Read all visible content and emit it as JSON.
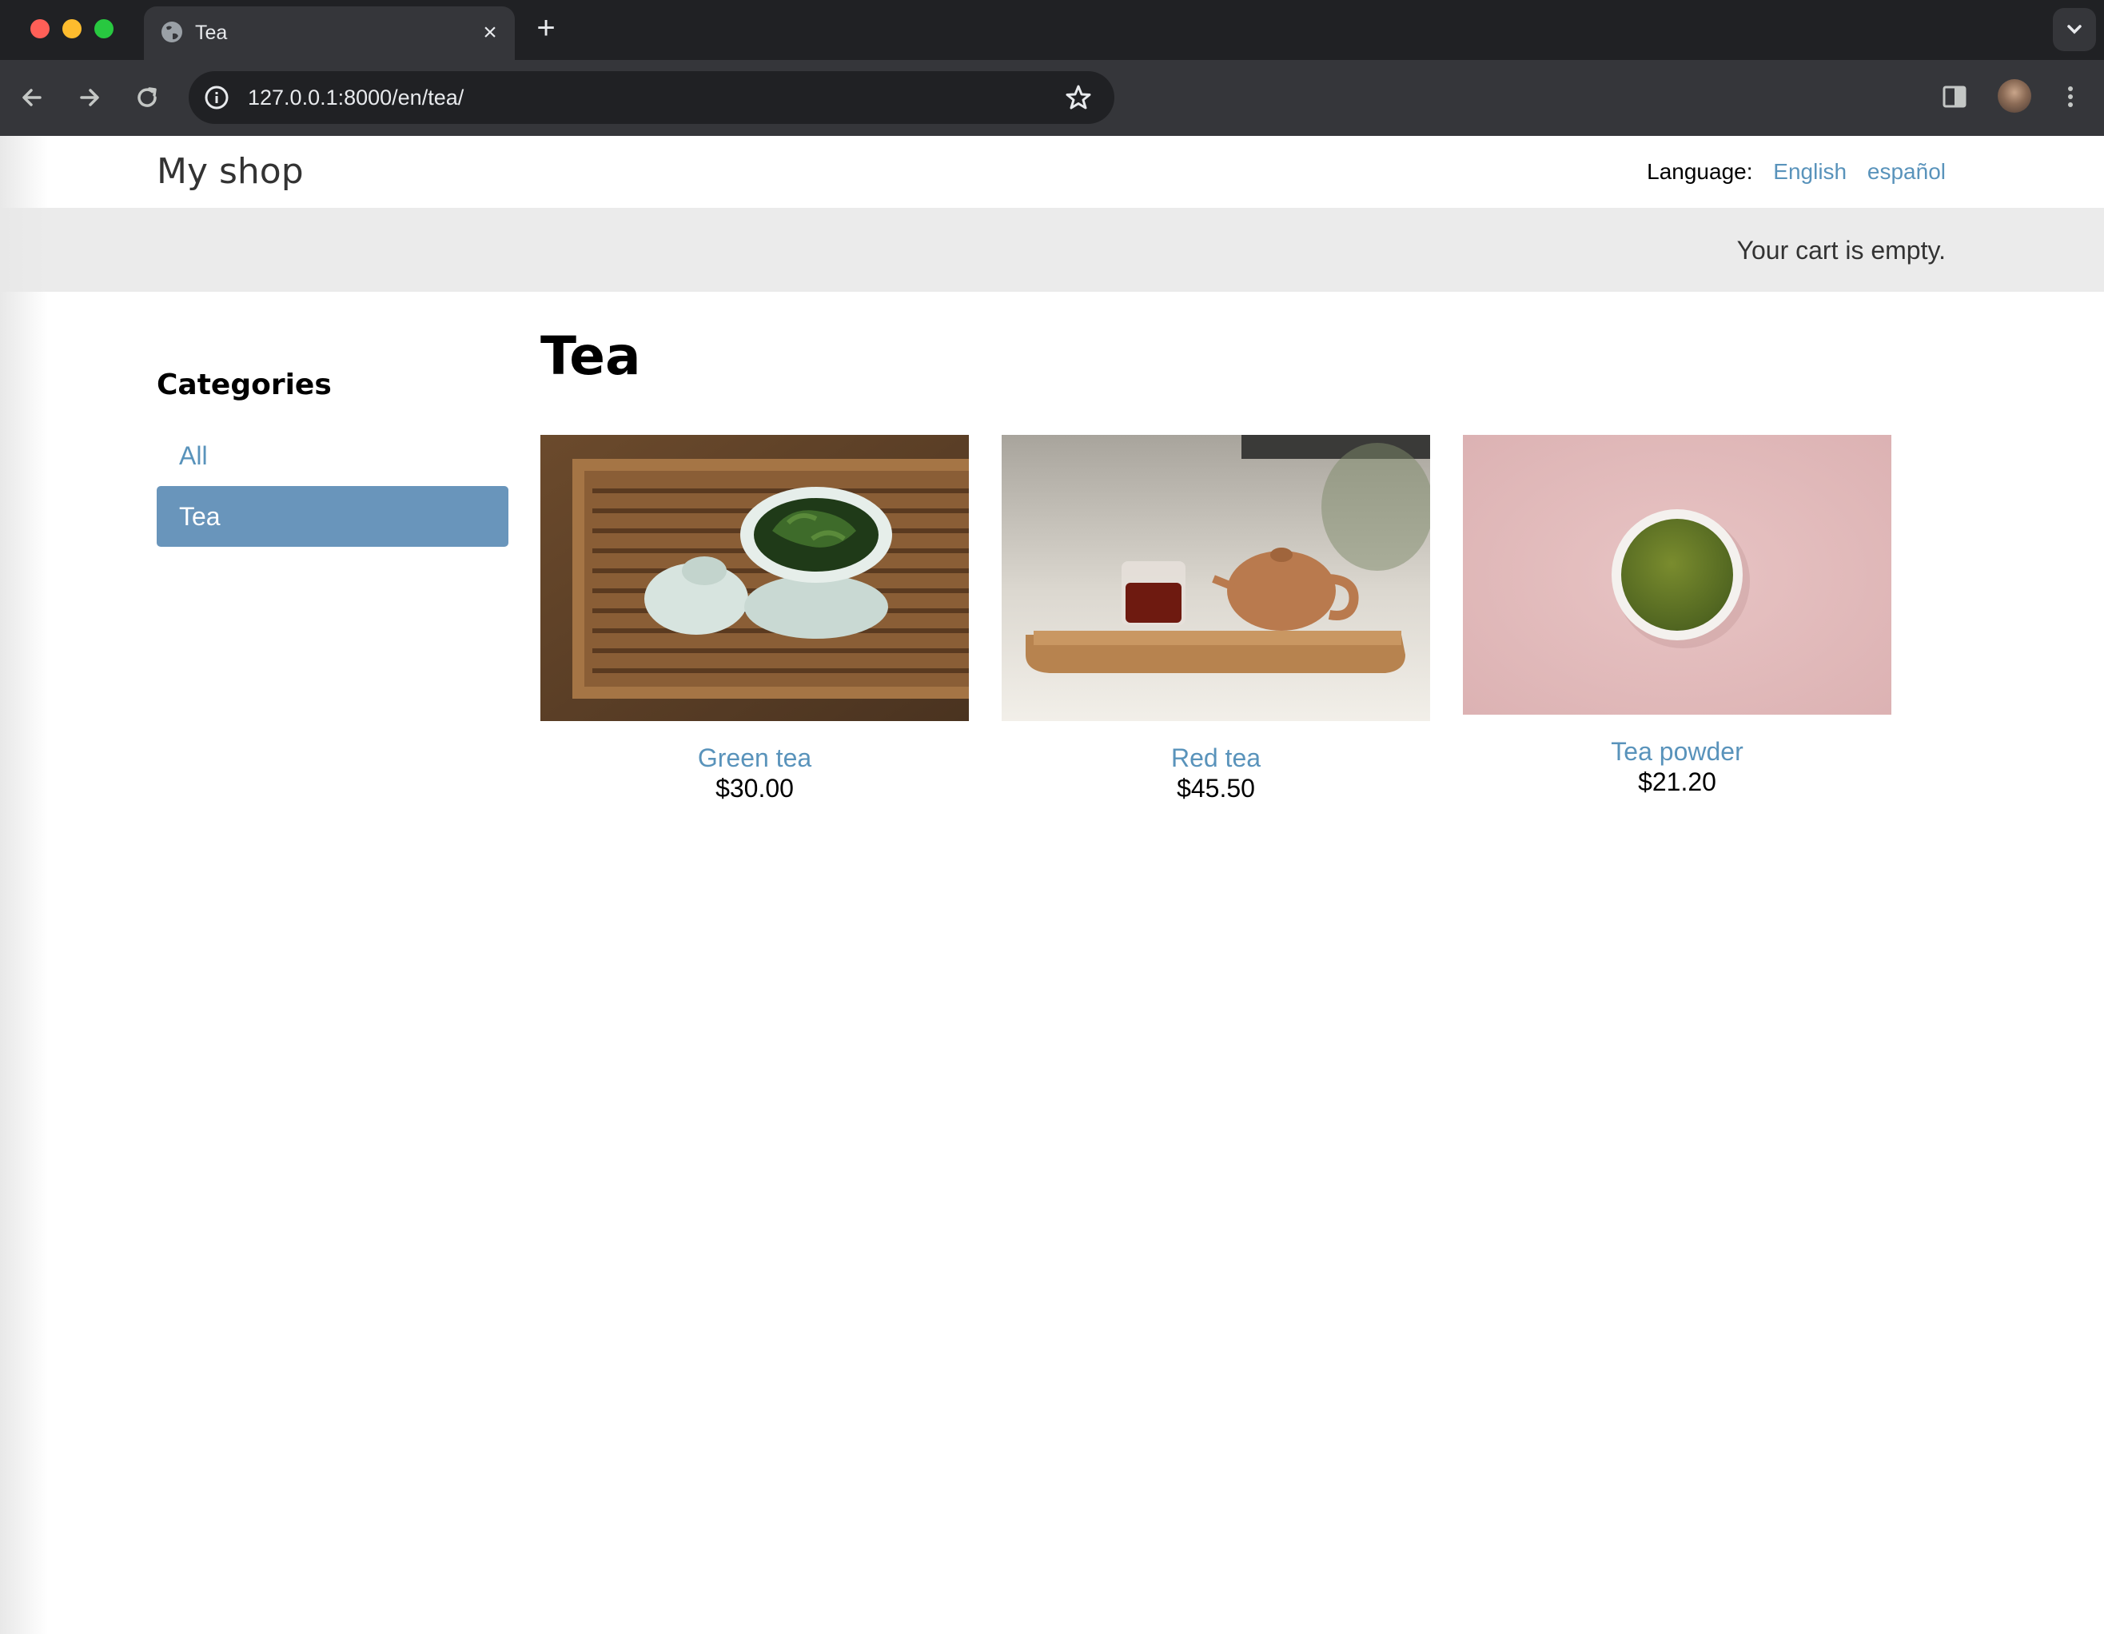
{
  "browser": {
    "tab_title": "Tea",
    "url": "127.0.0.1:8000/en/tea/"
  },
  "header": {
    "logo": "My shop",
    "language_label": "Language:",
    "languages": [
      "English",
      "español"
    ]
  },
  "cart": {
    "status": "Your cart is empty."
  },
  "sidebar": {
    "title": "Categories",
    "items": [
      {
        "label": "All",
        "selected": false
      },
      {
        "label": "Tea",
        "selected": true
      }
    ]
  },
  "main": {
    "title": "Tea",
    "products": [
      {
        "name": "Green tea",
        "price": "$30.00"
      },
      {
        "name": "Red tea",
        "price": "$45.50"
      },
      {
        "name": "Tea powder",
        "price": "$21.20"
      }
    ]
  },
  "colors": {
    "link": "#5993bb",
    "selected_category_bg": "#6995bb",
    "cart_bar_bg": "#ebebeb"
  }
}
